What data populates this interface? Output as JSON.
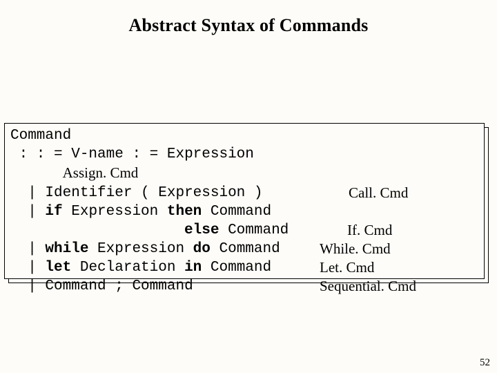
{
  "title": "Abstract Syntax of Commands",
  "page_number": "52",
  "grammar": {
    "head": "Command",
    "op": " : : = ",
    "bar": "  | ",
    "indent": "      ",
    "prod1": {
      "rule_a": "V-name",
      "rule_b": " : = ",
      "rule_c": "Expression",
      "label": "Assign. Cmd"
    },
    "prod2": {
      "rule_a": "Identifier",
      "rule_b": " ( ",
      "rule_c": "Expression",
      "rule_d": " )",
      "label": "Call. Cmd"
    },
    "prod3": {
      "rule_a": "if ",
      "rule_b": "Expression",
      "rule_c": " then ",
      "rule_d": "Command"
    },
    "prod3b": {
      "pad": "                    ",
      "rule_a": "else ",
      "rule_b": "Command",
      "label": "If. Cmd"
    },
    "prod4": {
      "rule_a": "while ",
      "rule_b": "Expression",
      "rule_c": " do ",
      "rule_d": "Command",
      "label": "While. Cmd"
    },
    "prod5": {
      "rule_a": "let ",
      "rule_b": "Declaration",
      "rule_c": " in ",
      "rule_d": "Command",
      "label": "Let. Cmd"
    },
    "prod6": {
      "rule_a": "Command",
      "rule_b": " ; ",
      "rule_c": "Command",
      "label": "Sequential. Cmd"
    }
  }
}
